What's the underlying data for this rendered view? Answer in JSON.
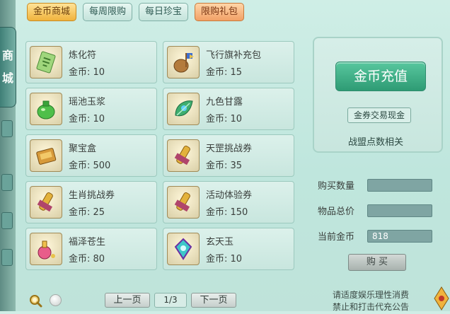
{
  "side_tab": {
    "char1": "商",
    "char2": "城"
  },
  "tabs": [
    {
      "label": "金币商城",
      "state": "active"
    },
    {
      "label": "每周限购",
      "state": "normal"
    },
    {
      "label": "每日珍宝",
      "state": "normal"
    },
    {
      "label": "限购礼包",
      "state": "special"
    }
  ],
  "items": [
    {
      "name": "炼化符",
      "price": "金币: 10",
      "icon": "talisman-icon"
    },
    {
      "name": "飞行旗补充包",
      "price": "金币: 15",
      "icon": "flag-pouch-icon"
    },
    {
      "name": "瑶池玉浆",
      "price": "金币: 10",
      "icon": "jade-jar-icon"
    },
    {
      "name": "九色甘露",
      "price": "金币: 10",
      "icon": "dew-leaf-icon"
    },
    {
      "name": "聚宝盒",
      "price": "金币: 500",
      "icon": "treasure-box-icon"
    },
    {
      "name": "天罡挑战券",
      "price": "金币: 35",
      "icon": "scroll-icon"
    },
    {
      "name": "生肖挑战券",
      "price": "金币: 25",
      "icon": "scroll-icon"
    },
    {
      "name": "活动体验券",
      "price": "金币: 150",
      "icon": "scroll-icon"
    },
    {
      "name": "福泽苍生",
      "price": "金币: 80",
      "icon": "potion-icon"
    },
    {
      "name": "玄天玉",
      "price": "金币: 10",
      "icon": "crystal-gem-icon"
    }
  ],
  "right": {
    "recharge_label": "金币充值",
    "coupon_label": "金券交易现金",
    "alliance_label": "战盟点数相关"
  },
  "purchase": {
    "qty_label": "购买数量",
    "qty_value": "",
    "total_label": "物品总价",
    "total_value": "",
    "current_label": "当前金币",
    "current_value": "818",
    "buy_label": "购 买"
  },
  "pager": {
    "prev": "上一页",
    "page": "1/3",
    "next": "下一页"
  },
  "notice": {
    "line1": "请适度娱乐理性消费",
    "line2": "禁止和打击代充公告"
  },
  "colors": {
    "accent_gold": "#f0b33c",
    "recharge_green": "#2e9b74",
    "panel_teal": "#c8e6de"
  }
}
